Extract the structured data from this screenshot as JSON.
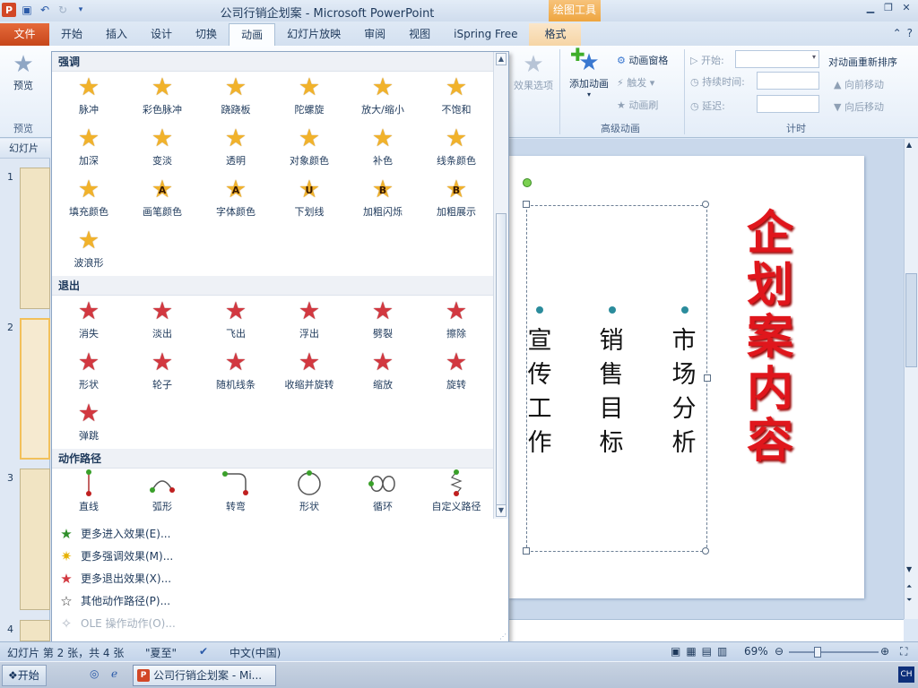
{
  "window": {
    "title": "公司行销企划案 - Microsoft PowerPoint",
    "context_tab_group": "绘图工具"
  },
  "tabs": [
    "文件",
    "开始",
    "插入",
    "设计",
    "切换",
    "动画",
    "幻灯片放映",
    "审阅",
    "视图",
    "iSpring Free",
    "格式"
  ],
  "active_tab": "动画",
  "ribbon": {
    "preview": {
      "label": "预览",
      "group": "预览"
    },
    "effect_options": "效果选项",
    "add_animation": "添加动画",
    "animation_pane": "动画窗格",
    "trigger": "触发",
    "animation_painter": "动画刷",
    "advanced_group": "高级动画",
    "start_label": "开始:",
    "duration_label": "持续时间:",
    "delay_label": "延迟:",
    "timing_group": "计时",
    "reorder_title": "对动画重新排序",
    "move_earlier": "向前移动",
    "move_later": "向后移动"
  },
  "left_panel": {
    "header": "幻灯片",
    "slide_numbers": [
      "1",
      "2",
      "3",
      "4"
    ]
  },
  "gallery": {
    "sections": [
      {
        "title": "强调",
        "items": [
          "脉冲",
          "彩色脉冲",
          "跷跷板",
          "陀螺旋",
          "放大/缩小",
          "不饱和",
          "加深",
          "变淡",
          "透明",
          "对象颜色",
          "补色",
          "线条颜色",
          "填充颜色",
          "画笔颜色",
          "字体颜色",
          "下划线",
          "加粗闪烁",
          "加粗展示",
          "波浪形"
        ]
      },
      {
        "title": "退出",
        "items": [
          "消失",
          "淡出",
          "飞出",
          "浮出",
          "劈裂",
          "擦除",
          "形状",
          "轮子",
          "随机线条",
          "收缩并旋转",
          "缩放",
          "旋转",
          "弹跳"
        ]
      },
      {
        "title": "动作路径",
        "items": [
          "直线",
          "弧形",
          "转弯",
          "形状",
          "循环",
          "自定义路径"
        ]
      }
    ],
    "emphasis_glyphs": {
      "画笔颜色": "A",
      "字体颜色": "A",
      "下划线": "U",
      "加粗闪烁": "B",
      "加粗展示": "B"
    },
    "menu": [
      {
        "label": "更多进入效果(E)...",
        "icon": "star-green-icon",
        "enabled": true
      },
      {
        "label": "更多强调效果(M)...",
        "icon": "star-yellow-icon",
        "enabled": true
      },
      {
        "label": "更多退出效果(X)...",
        "icon": "star-red-icon",
        "enabled": true
      },
      {
        "label": "其他动作路径(P)...",
        "icon": "star-outline-icon",
        "enabled": true
      },
      {
        "label": "OLE 操作动作(O)...",
        "icon": "gear-icon",
        "enabled": false
      }
    ]
  },
  "slide": {
    "title": "企划案内容",
    "columns": [
      {
        "text": "宣传工作"
      },
      {
        "text": "销售目标"
      },
      {
        "text": "市场分析"
      }
    ]
  },
  "status": {
    "slide_info": "幻灯片 第 2 张，共 4 张",
    "theme": "\"夏至\"",
    "language": "中文(中国)",
    "zoom": "69%"
  },
  "taskbar": {
    "start": "开始",
    "task_item": "公司行销企划案 - Mi...",
    "tray": "CH"
  },
  "colors": {
    "file_tab": "#d24726",
    "title_red": "#e0161c",
    "context_tab": "#eea53f",
    "emphasis_star": "#f1b22b",
    "exit_star": "#d23840"
  }
}
